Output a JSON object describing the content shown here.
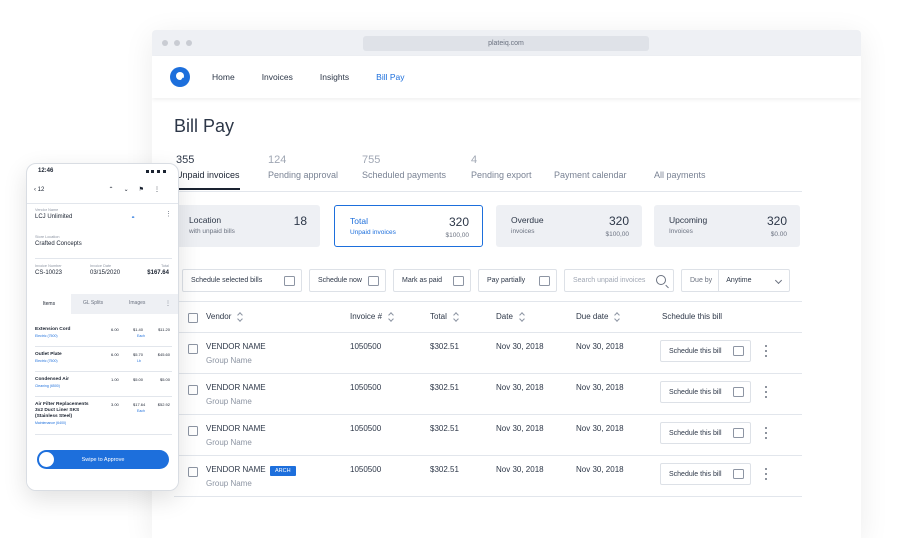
{
  "browser": {
    "url": "plateiq.com"
  },
  "nav": {
    "items": [
      "Home",
      "Invoices",
      "Insights",
      "Bill Pay"
    ],
    "active": "Bill Pay"
  },
  "page": {
    "title": "Bill Pay"
  },
  "tabs": [
    {
      "count": "355",
      "label": "Unpaid invoices"
    },
    {
      "count": "124",
      "label": "Pending approval"
    },
    {
      "count": "755",
      "label": "Scheduled payments"
    },
    {
      "count": "4",
      "label": "Pending export"
    },
    {
      "count": "",
      "label": "Payment calendar"
    },
    {
      "count": "",
      "label": "All payments"
    }
  ],
  "cards": [
    {
      "title": "Location",
      "sub": "with unpaid bills",
      "value": "18",
      "amount": ""
    },
    {
      "title": "Total",
      "sub": "Unpaid invoices",
      "value": "320",
      "amount": "$100,00"
    },
    {
      "title": "Overdue",
      "sub": "invoices",
      "value": "320",
      "amount": "$100,00"
    },
    {
      "title": "Upcoming",
      "sub": "Invoices",
      "value": "320",
      "amount": "$0.00"
    }
  ],
  "toolbar": {
    "schedule_selected": "Schedule selected bills",
    "schedule_now": "Schedule now",
    "mark_as_paid": "Mark as paid",
    "pay_partially": "Pay partially",
    "search_placeholder": "Search unpaid invoices",
    "due_by": "Due by",
    "due_value": "Anytime"
  },
  "table": {
    "headers": {
      "vendor": "Vendor",
      "invoice": "Invoice #",
      "total": "Total",
      "date": "Date",
      "due": "Due date",
      "schedule": "Schedule this bill"
    },
    "rows": [
      {
        "vendor": "VENDOR NAME",
        "group": "Group Name",
        "badge": "",
        "invoice": "1050500",
        "total": "$302.51",
        "date": "Nov 30, 2018",
        "due": "Nov 30, 2018",
        "action": "Schedule this bill"
      },
      {
        "vendor": "VENDOR NAME",
        "group": "Group Name",
        "badge": "",
        "invoice": "1050500",
        "total": "$302.51",
        "date": "Nov 30, 2018",
        "due": "Nov 30, 2018",
        "action": "Schedule this bill"
      },
      {
        "vendor": "VENDOR NAME",
        "group": "Group Name",
        "badge": "",
        "invoice": "1050500",
        "total": "$302.51",
        "date": "Nov 30, 2018",
        "due": "Nov 30, 2018",
        "action": "Schedule this bill"
      },
      {
        "vendor": "VENDOR NAME",
        "group": "Group Name",
        "badge": "ARCH",
        "invoice": "1050500",
        "total": "$302.51",
        "date": "Nov 30, 2018",
        "due": "Nov 30, 2018",
        "action": "Schedule this bill"
      }
    ]
  },
  "phone": {
    "time": "12:46",
    "back_count": "12",
    "vendor_label": "Vendor Name",
    "vendor_value": "LCJ Unlimited",
    "store_label": "Store Location",
    "store_value": "Crafted Concepts",
    "invoice_number_label": "Invoice Number",
    "invoice_number_value": "CS-10023",
    "invoice_date_label": "Invoice Date",
    "invoice_date_value": "03/15/2020",
    "total_label": "Total",
    "total_value": "$167.64",
    "tabs": [
      "Items",
      "GL Splits",
      "Images"
    ],
    "items": [
      {
        "name": "Extension Cord",
        "category": "Electric (7500)",
        "qty": "6.00",
        "price": "$1.40",
        "unit": "Each",
        "total": "$11.20"
      },
      {
        "name": "Outlet Plate",
        "category": "Electric (7500)",
        "qty": "6.00",
        "price": "$5.70",
        "unit": "Lb",
        "total": "$45.60"
      },
      {
        "name": "Condensed Air",
        "category": "Cleaning (6500)",
        "qty": "1.00",
        "price": "$5.00",
        "unit": "",
        "total": "$5.00"
      },
      {
        "name": "Air Filter Replacements 3x2 Duct Liner SKS (Stainless Steel)",
        "category": "Maintenance (6400)",
        "qty": "3.00",
        "price": "$17.64",
        "unit": "Each",
        "total": "$52.92"
      }
    ],
    "swipe_label": "Swipe to Approve"
  }
}
